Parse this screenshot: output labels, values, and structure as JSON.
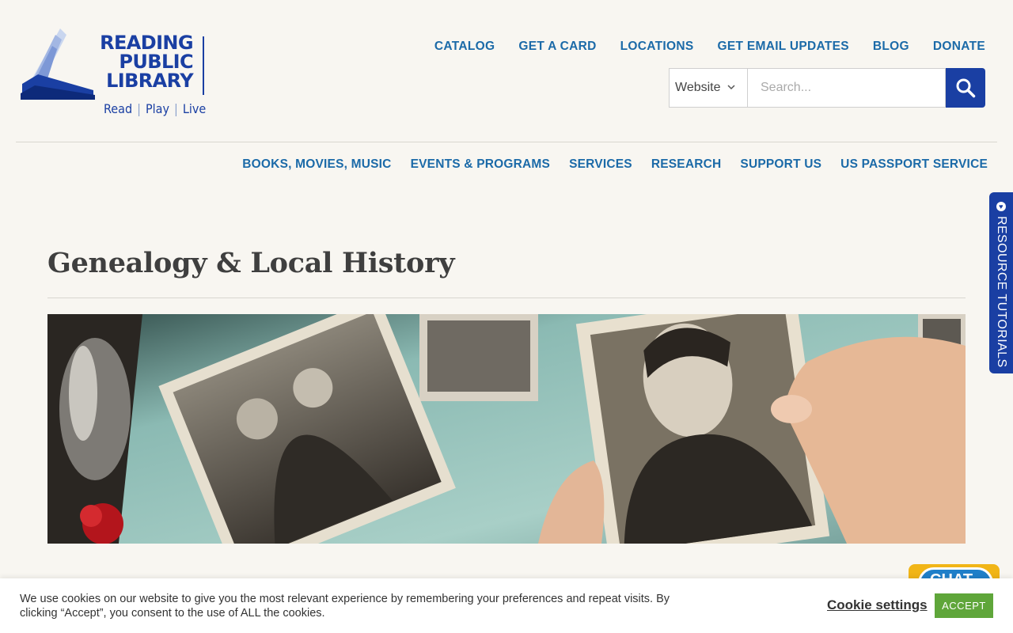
{
  "logo": {
    "line1": "READING",
    "line2": "PUBLIC",
    "line3": "LIBRARY",
    "tagline": [
      "Read",
      "Play",
      "Live"
    ]
  },
  "top_nav": [
    "CATALOG",
    "GET A CARD",
    "LOCATIONS",
    "GET EMAIL UPDATES",
    "BLOG",
    "DONATE"
  ],
  "search": {
    "scope": "Website",
    "placeholder": "Search..."
  },
  "main_nav": [
    "BOOKS, MOVIES, MUSIC",
    "EVENTS & PROGRAMS",
    "SERVICES",
    "RESEARCH",
    "SUPPORT US",
    "US PASSPORT SERVICE"
  ],
  "side_tab": {
    "label": "RESOURCE TUTORIALS"
  },
  "page": {
    "title": "Genealogy & Local History"
  },
  "chat": {
    "label": "CHAT"
  },
  "cookie": {
    "text": "We use cookies on our website to give you the most relevant experience by remembering your preferences and repeat visits. By clicking “Accept”, you consent to the use of ALL the cookies.",
    "settings_label": "Cookie settings",
    "accept_label": "ACCEPT"
  },
  "colors": {
    "brand_blue": "#1a3fa3",
    "link_blue": "#1b6aa8",
    "accept_green": "#5fa63a",
    "chat_yellow": "#f1b517"
  }
}
